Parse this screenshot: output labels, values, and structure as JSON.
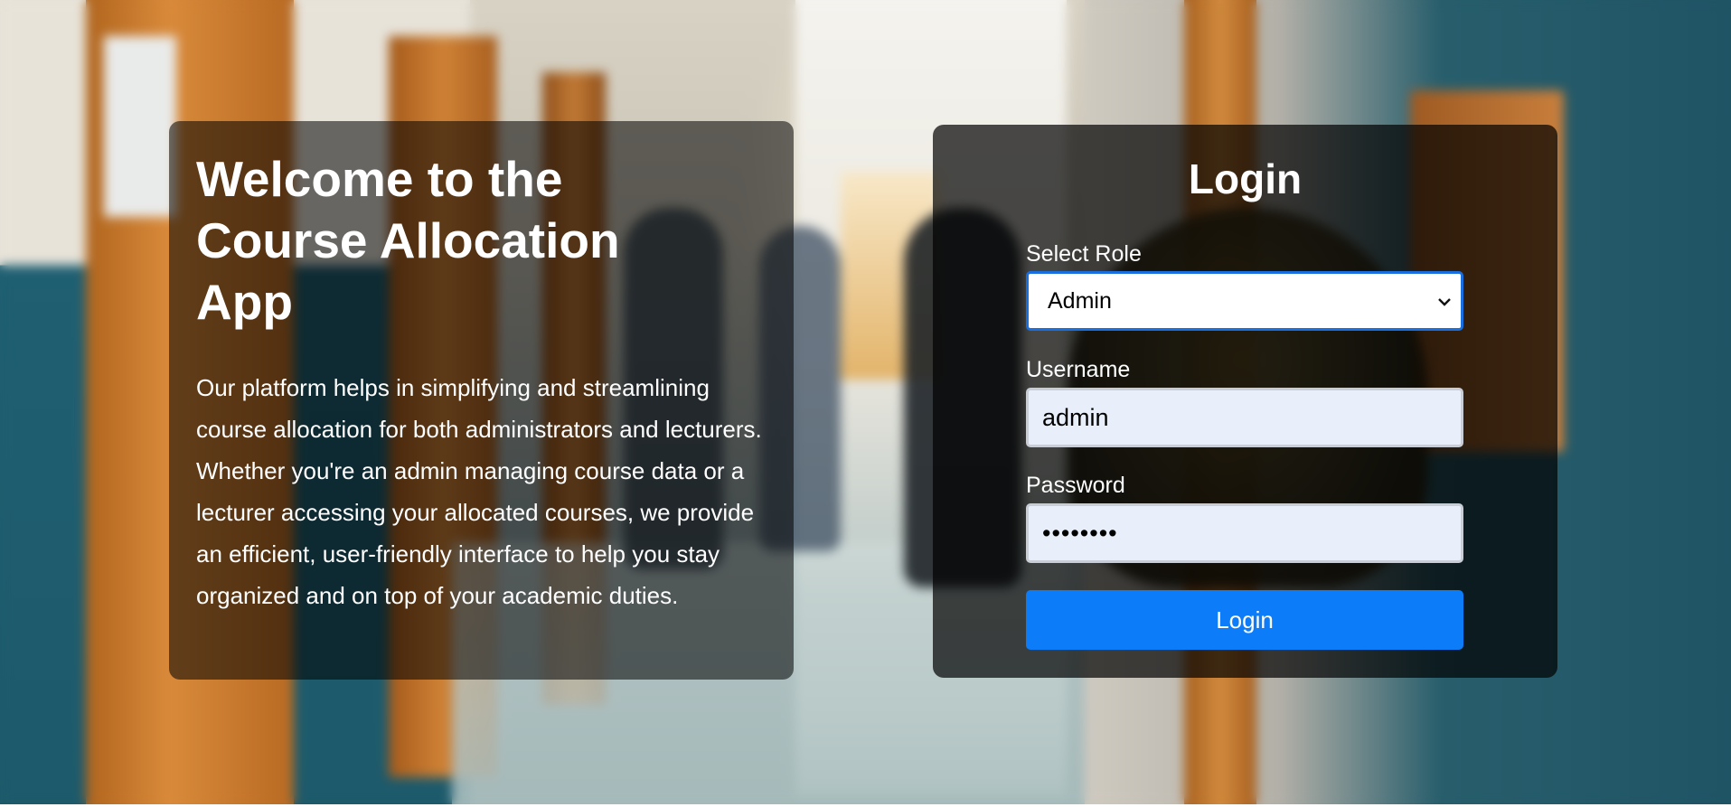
{
  "hero": {
    "title": "Welcome to the Course Allocation App",
    "description": "Our platform helps in simplifying and streamlining course allocation for both administrators and lecturers. Whether you're an admin managing course data or a lecturer accessing your allocated courses, we provide an efficient, user-friendly interface to help you stay organized and on top of your academic duties."
  },
  "login": {
    "title": "Login",
    "role_label": "Select Role",
    "role_value": "Admin",
    "username_label": "Username",
    "username_value": "admin",
    "password_label": "Password",
    "password_value": "••••••••",
    "submit_label": "Login"
  },
  "icons": {
    "select_chevron": "chevron-down-icon"
  },
  "colors": {
    "primary_button": "#0d7cf8",
    "focus_border": "#1a6fe0",
    "input_background": "#e8effb"
  }
}
